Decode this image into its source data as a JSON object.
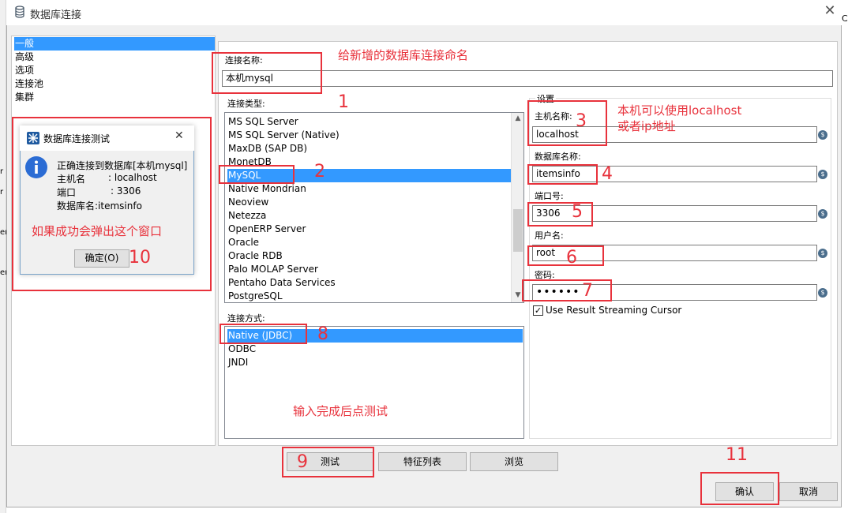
{
  "window": {
    "title": "数据库连接",
    "right_edge_fragment": "C",
    "left_edge_fragments": [
      "r",
      "en",
      "er"
    ]
  },
  "nav": {
    "items": [
      {
        "label": "一般",
        "selected": true
      },
      {
        "label": "高级",
        "selected": false
      },
      {
        "label": "选项",
        "selected": false
      },
      {
        "label": "连接池",
        "selected": false
      },
      {
        "label": "集群",
        "selected": false
      }
    ]
  },
  "form": {
    "connection_name_label": "连接名称:",
    "connection_name_value": "本机mysql",
    "connection_type_label": "连接类型:",
    "connection_types": [
      "MS SQL Server",
      "MS SQL Server (Native)",
      "MaxDB (SAP DB)",
      "MonetDB",
      "MySQL",
      "Native Mondrian",
      "Neoview",
      "Netezza",
      "OpenERP Server",
      "Oracle",
      "Oracle RDB",
      "Palo MOLAP Server",
      "Pentaho Data Services",
      "PostgreSQL"
    ],
    "selected_type": "MySQL",
    "access_label": "连接方式:",
    "access_methods": [
      "Native (JDBC)",
      "ODBC",
      "JNDI"
    ],
    "selected_access": "Native (JDBC)",
    "settings_label": "设置",
    "host_label": "主机名称:",
    "host_value": "localhost",
    "db_label": "数据库名称:",
    "db_value": "itemsinfo",
    "port_label": "端口号:",
    "port_value": "3306",
    "user_label": "用户名:",
    "user_value": "root",
    "password_label": "密码:",
    "password_value": "••••••",
    "streaming_cursor_label": "Use Result Streaming Cursor",
    "streaming_cursor_checked": true
  },
  "buttons": {
    "test": "测试",
    "feature_list": "特征列表",
    "explore": "浏览",
    "ok": "确认",
    "cancel": "取消"
  },
  "dialog": {
    "title": "数据库连接测试",
    "line1": "正确连接到数据库[本机mysql]",
    "host_key": "主机名",
    "host_sep": ": localhost",
    "port_key": "端口",
    "port_sep": ": 3306",
    "db_line": "数据库名:itemsinfo",
    "ok_button": "确定(O)",
    "close": "✕"
  },
  "annotations": {
    "name_hint": "给新增的数据库连接命名",
    "host_hint_1": "本机可以使用localhost",
    "host_hint_2": "或者ip地址",
    "test_hint": "输入完成后点测试",
    "popup_hint": "如果成功会弹出这个窗口",
    "n1": "1",
    "n2": "2",
    "n3": "3",
    "n4": "4",
    "n5": "5",
    "n6": "6",
    "n7": "7",
    "n8": "8",
    "n9": "9",
    "n10": "10",
    "n11": "11"
  },
  "colors": {
    "selection": "#3399ff",
    "annotation_red": "#e8323c"
  },
  "icons": {
    "window": "database-icon",
    "dialog_title": "pentaho-spoon-icon",
    "dialog_info": "info-icon",
    "variable": "variable-dollar-icon",
    "close": "close-icon"
  }
}
